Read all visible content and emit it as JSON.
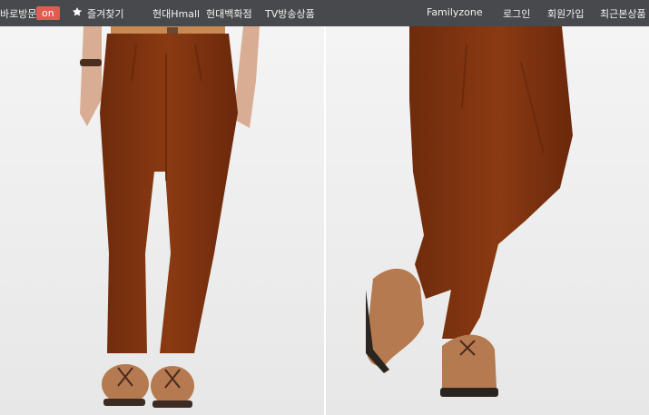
{
  "topbar": {
    "direct_visit_label": "바로방문",
    "direct_visit_badge": "on",
    "favorites_label": "즐겨찾기",
    "links": [
      "현대Hmall",
      "현대백화점",
      "TV방송상품"
    ],
    "right_links": [
      "Familyzone",
      "로그인",
      "회원가입",
      "최근본상품"
    ]
  },
  "colors": {
    "topbar_bg": "#47494d",
    "badge": "#e35b4f",
    "pants": "#8a3a12",
    "shoes": "#b57a4f"
  }
}
